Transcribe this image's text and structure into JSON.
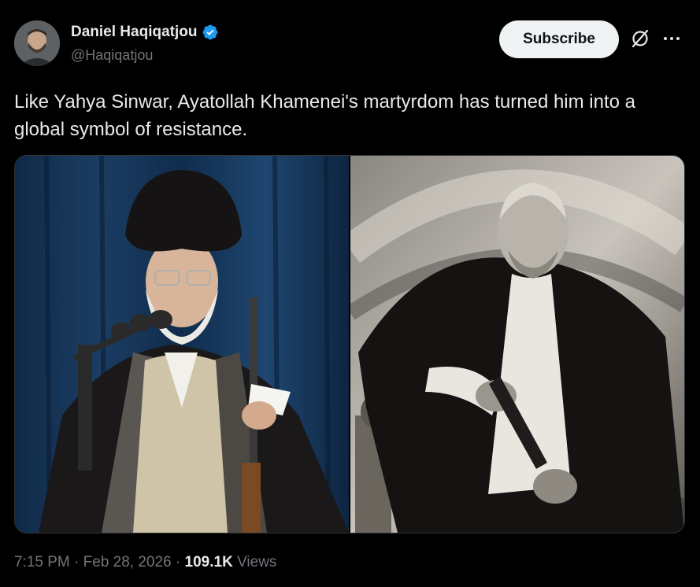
{
  "author": {
    "display_name": "Daniel Haqiqatjou",
    "handle": "@Haqiqatjou",
    "verified": true
  },
  "actions": {
    "subscribe_label": "Subscribe",
    "grok_icon": "slashed-circle-icon",
    "more_icon": "more-dots-icon"
  },
  "tweet": {
    "text": "Like Yahya Sinwar, Ayatollah Khamenei's martyrdom has turned him into a global symbol of resistance."
  },
  "media": {
    "left_image": "photo-cleric-at-microphones",
    "right_image": "photo-man-holding-pistol-bw"
  },
  "meta": {
    "time": "7:15 PM",
    "date": "Feb 28, 2026",
    "separator": "·",
    "views_count": "109.1K",
    "views_label": "Views"
  },
  "colors": {
    "background": "#000000",
    "text_primary": "#e7e9ea",
    "text_secondary": "#71767b",
    "verified_blue": "#1d9bf0",
    "button_bg": "#eff3f4"
  }
}
